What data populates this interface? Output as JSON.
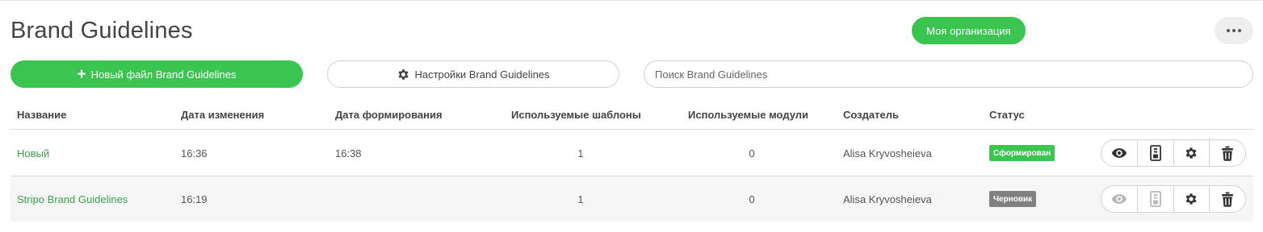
{
  "page": {
    "title": "Brand Guidelines"
  },
  "header": {
    "org_button": "Моя организация",
    "more_icon": "ellipsis-icon"
  },
  "toolbar": {
    "new_button": "Новый файл Brand Guidelines",
    "settings_button": "Настройки Brand Guidelines",
    "search_placeholder": "Поиск Brand Guidelines",
    "search_value": ""
  },
  "table": {
    "columns": [
      "Название",
      "Дата изменения",
      "Дата формирования",
      "Используемые шаблоны",
      "Используемые модули",
      "Создатель",
      "Статус"
    ],
    "rows": [
      {
        "name": "Новый",
        "modified": "16:36",
        "generated": "16:38",
        "templates": "1",
        "modules": "0",
        "creator": "Alisa Kryvosheieva",
        "status": "Сформирован",
        "status_color": "#3ac551",
        "preview_enabled": true,
        "export_enabled": true
      },
      {
        "name": "Stripo Brand Guidelines",
        "modified": "16:19",
        "generated": "",
        "templates": "1",
        "modules": "0",
        "creator": "Alisa Kryvosheieva",
        "status": "Черновик",
        "status_color": "#808080",
        "preview_enabled": false,
        "export_enabled": false
      }
    ]
  },
  "colors": {
    "accent": "#3ac551",
    "link": "#3aa24c",
    "draft": "#808080"
  },
  "icons": [
    "plus-icon",
    "gear-icon",
    "eye-icon",
    "export-file-icon",
    "gear-icon",
    "trash-icon"
  ]
}
